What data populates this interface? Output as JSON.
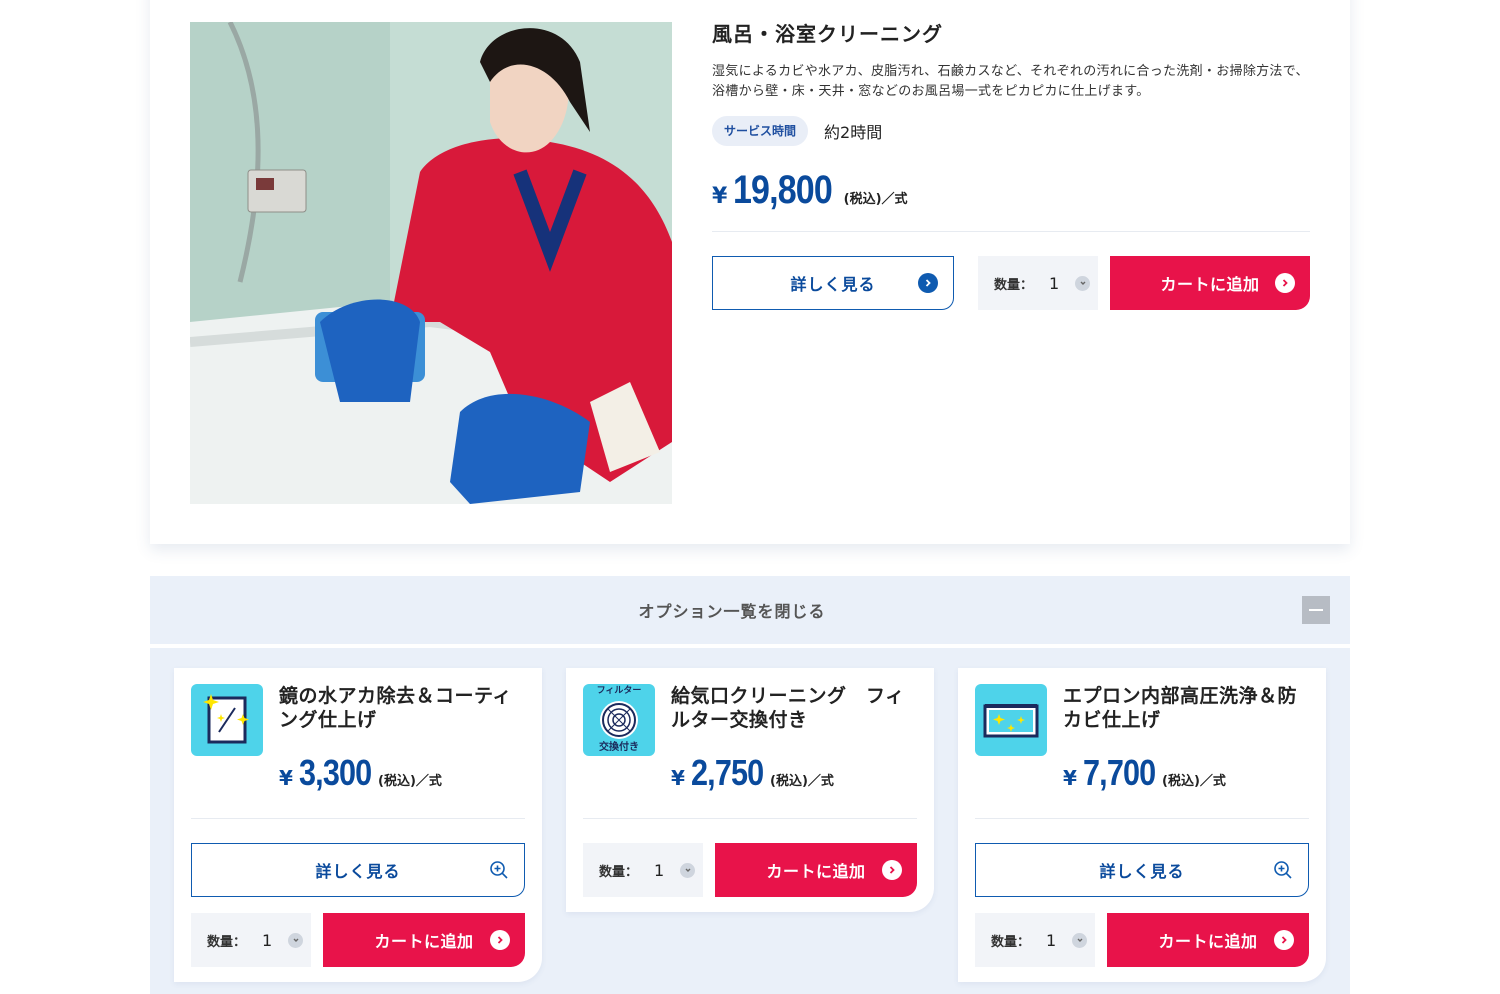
{
  "service": {
    "title": "風呂・浴室クリーニング",
    "description": "湿気によるカビや水アカ、皮脂汚れ、石鹸カスなど、それぞれの汚れに合った洗剤・お掃除方法で、浴槽から壁・床・天井・窓などのお風呂場一式をピカピカに仕上げます。",
    "time_label": "サービス時間",
    "time_value": "約2時間",
    "currency": "¥",
    "price": "19,800",
    "price_suffix": "(税込)／式",
    "detail_label": "詳しく見る",
    "qty_label": "数量：",
    "qty_value": "1",
    "cart_label": "カートに追加"
  },
  "options_header": {
    "label": "オプション一覧を閉じる"
  },
  "options": [
    {
      "title": "鏡の水アカ除去＆コーティング仕上げ",
      "currency": "¥",
      "price": "3,300",
      "price_suffix": "(税込)／式",
      "detail_label": "詳しく見る",
      "qty_label": "数量：",
      "qty_value": "1",
      "cart_label": "カートに追加"
    },
    {
      "title": "給気口クリーニング　フィルター交換付き",
      "icon_top_text": "フィルター",
      "icon_bottom_text": "交換付き",
      "currency": "¥",
      "price": "2,750",
      "price_suffix": "(税込)／式",
      "qty_label": "数量：",
      "qty_value": "1",
      "cart_label": "カートに追加"
    },
    {
      "title": "エプロン内部高圧洗浄＆防カビ仕上げ",
      "currency": "¥",
      "price": "7,700",
      "price_suffix": "(税込)／式",
      "detail_label": "詳しく見る",
      "qty_label": "数量：",
      "qty_value": "1",
      "cart_label": "カートに追加"
    }
  ],
  "colors": {
    "brand_blue": "#0a4a9c",
    "cart_red": "#e8134a",
    "option_bg": "#eaf0f9",
    "icon_cyan": "#4ed3ea"
  }
}
